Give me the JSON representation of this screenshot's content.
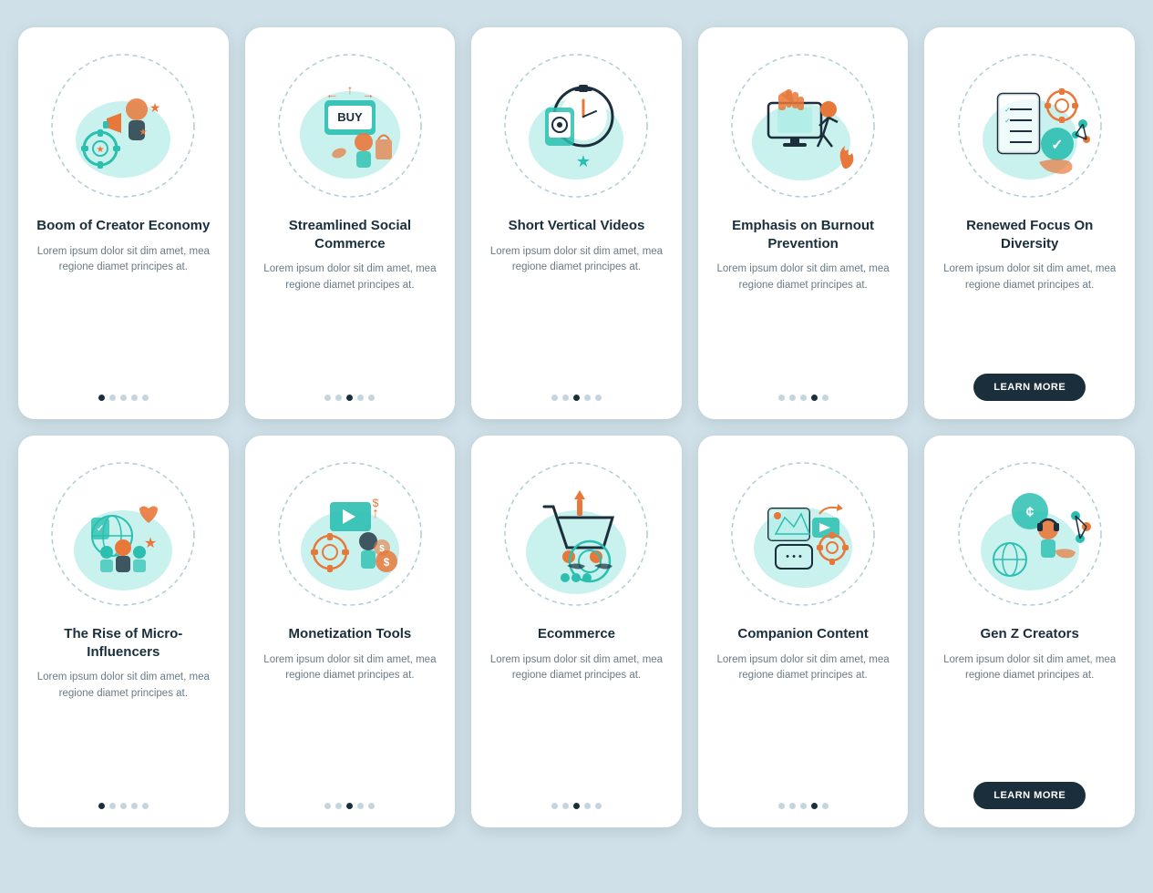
{
  "cards": [
    {
      "id": "creator-economy",
      "title": "Boom of\nCreator Economy",
      "desc": "Lorem ipsum dolor sit dim amet, mea regione diamet principes at.",
      "dots": [
        1,
        0,
        0,
        0,
        0
      ],
      "hasButton": false
    },
    {
      "id": "social-commerce",
      "title": "Streamlined\nSocial Commerce",
      "desc": "Lorem ipsum dolor sit dim amet, mea regione diamet principes at.",
      "dots": [
        0,
        0,
        1,
        0,
        0
      ],
      "hasButton": false
    },
    {
      "id": "vertical-videos",
      "title": "Short Vertical\nVideos",
      "desc": "Lorem ipsum dolor sit dim amet, mea regione diamet principes at.",
      "dots": [
        0,
        0,
        1,
        0,
        0
      ],
      "hasButton": false
    },
    {
      "id": "burnout-prevention",
      "title": "Emphasis on\nBurnout Prevention",
      "desc": "Lorem ipsum dolor sit dim amet, mea regione diamet principes at.",
      "dots": [
        0,
        0,
        0,
        1,
        0
      ],
      "hasButton": false
    },
    {
      "id": "diversity",
      "title": "Renewed Focus\nOn Diversity",
      "desc": "Lorem ipsum dolor sit dim amet, mea regione diamet principes at.",
      "dots": [
        0,
        0,
        0,
        0,
        1
      ],
      "hasButton": true,
      "buttonLabel": "LEARN MORE"
    },
    {
      "id": "micro-influencers",
      "title": "The Rise of\nMicro-Influencers",
      "desc": "Lorem ipsum dolor sit dim amet, mea regione diamet principes at.",
      "dots": [
        1,
        0,
        0,
        0,
        0
      ],
      "hasButton": false
    },
    {
      "id": "monetization-tools",
      "title": "Monetization Tools",
      "desc": "Lorem ipsum dolor sit dim amet, mea regione diamet principes at.",
      "dots": [
        0,
        0,
        1,
        0,
        0
      ],
      "hasButton": false
    },
    {
      "id": "ecommerce",
      "title": "Ecommerce",
      "desc": "Lorem ipsum dolor sit dim amet, mea regione diamet principes at.",
      "dots": [
        0,
        0,
        1,
        0,
        0
      ],
      "hasButton": false
    },
    {
      "id": "companion-content",
      "title": "Companion\nContent",
      "desc": "Lorem ipsum dolor sit dim amet, mea regione diamet principes at.",
      "dots": [
        0,
        0,
        0,
        1,
        0
      ],
      "hasButton": false
    },
    {
      "id": "gen-z-creators",
      "title": "Gen Z Creators",
      "desc": "Lorem ipsum dolor sit dim amet, mea regione diamet principes at.",
      "dots": [
        0,
        0,
        0,
        0,
        1
      ],
      "hasButton": true,
      "buttonLabel": "LEARN MORE"
    }
  ]
}
